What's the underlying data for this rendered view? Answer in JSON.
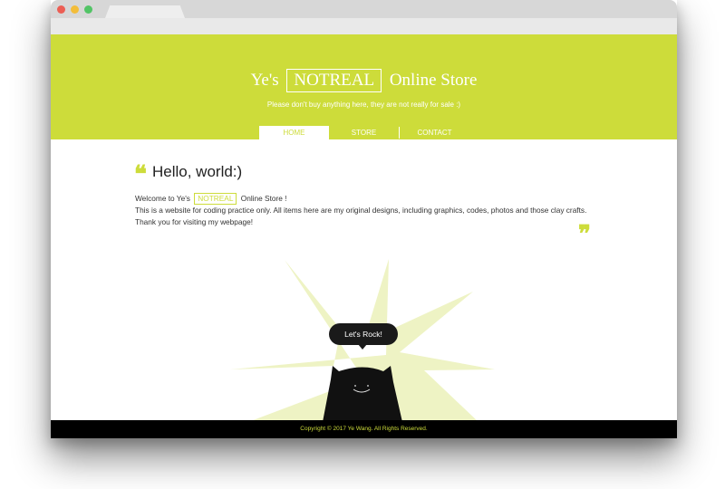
{
  "brand": {
    "prefix": "Ye's",
    "boxed": "NOTREAL",
    "suffix": "Online Store",
    "tagline": "Please don't buy anything here, they are not really for sale :)"
  },
  "nav": {
    "home": "HOME",
    "store": "STORE",
    "contact": "CONTACT"
  },
  "content": {
    "open_quote": "❝",
    "heading": "Hello, world:)",
    "welcome_prefix": "Welcome to Ye's",
    "welcome_box": "NOTREAL",
    "welcome_suffix": "Online Store !",
    "body": "This is a website for coding practice only. All items here are my original designs, including graphics, codes, photos and those clay crafts. Thank you for visiting my webpage!",
    "close_quote": "❞"
  },
  "speech_bubble": "Let's Rock!",
  "footer": "Copyright © 2017 Ye Wang. All Rights Reserved.",
  "colors": {
    "accent": "#cddc3a",
    "burst": "#eef3c4",
    "cat": "#111111",
    "footer_bg": "#000000"
  }
}
